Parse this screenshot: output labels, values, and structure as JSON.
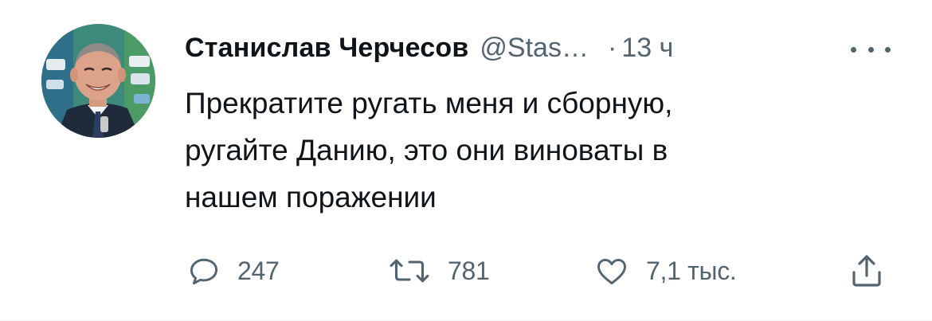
{
  "tweet": {
    "author": {
      "display_name": "Станислав Черчесов",
      "handle": "@Stas…",
      "avatar_icon": "avatar-photo"
    },
    "separator": "·",
    "time": "13 ч",
    "text_lines": [
      "Прекратите ругать меня и сборную,",
      "ругайте Данию, это они виноваты в",
      "нашем поражении"
    ],
    "actions": {
      "reply": {
        "icon": "reply-icon",
        "count": "247"
      },
      "retweet": {
        "icon": "retweet-icon",
        "count": "781"
      },
      "like": {
        "icon": "heart-icon",
        "count": "7,1 тыс."
      },
      "share": {
        "icon": "share-icon"
      }
    },
    "more_icon": "more-icon"
  },
  "colors": {
    "text_primary": "#0f1419",
    "text_secondary": "#536471",
    "divider": "#eff3f4"
  }
}
